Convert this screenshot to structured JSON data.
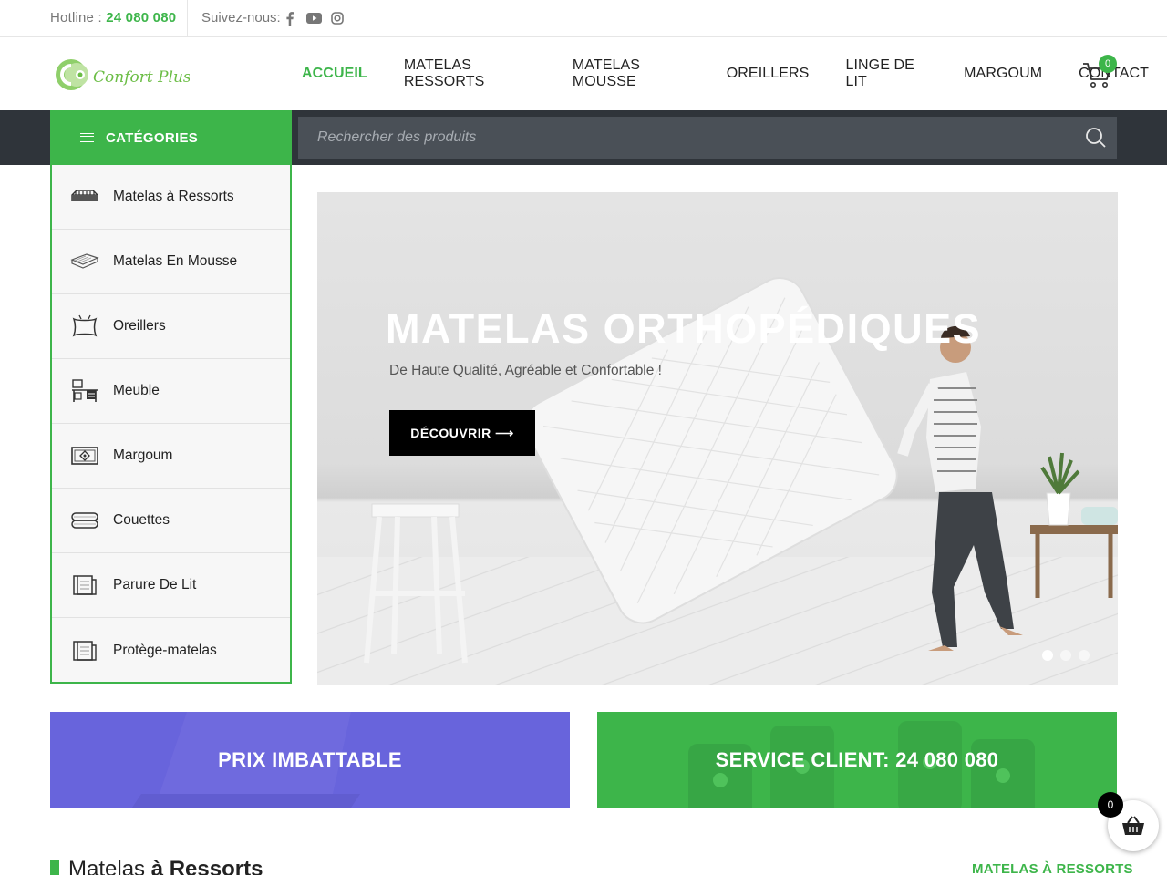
{
  "topbar": {
    "hotline_label": "Hotline : ",
    "hotline_number": "24 080 080",
    "follow_label": "Suivez-nous:"
  },
  "header": {
    "logo_text": "Confort Plus",
    "nav": [
      {
        "label": "ACCUEIL",
        "active": true
      },
      {
        "label": "MATELAS RESSORTS"
      },
      {
        "label": "MATELAS MOUSSE"
      },
      {
        "label": "OREILLERS"
      },
      {
        "label": "LINGE DE LIT"
      },
      {
        "label": "MARGOUM"
      },
      {
        "label": "CONTACT"
      }
    ],
    "cart_count": "0"
  },
  "search": {
    "categories_label": "CATÉGORIES",
    "placeholder": "Rechercher des produits"
  },
  "categories": [
    {
      "label": "Matelas à Ressorts",
      "icon": "spring-mattress-icon"
    },
    {
      "label": "Matelas En Mousse",
      "icon": "foam-mattress-icon"
    },
    {
      "label": "Oreillers",
      "icon": "pillow-icon"
    },
    {
      "label": "Meuble",
      "icon": "furniture-icon"
    },
    {
      "label": "Margoum",
      "icon": "rug-icon"
    },
    {
      "label": "Couettes",
      "icon": "duvet-icon"
    },
    {
      "label": "Parure De Lit",
      "icon": "bedding-set-icon"
    },
    {
      "label": "Protège-matelas",
      "icon": "mattress-protector-icon"
    }
  ],
  "hero": {
    "title": "MATELAS ORTHOPÉDIQUES",
    "subtitle": "De Haute Qualité, Agréable et Confortable !",
    "button": "DÉCOUVRIR ⟶",
    "slide_count": 3,
    "active_slide": 1
  },
  "banners": [
    {
      "label": "PRIX IMBATTABLE",
      "color": "#6864dc"
    },
    {
      "label": "SERVICE CLIENT: 24 080 080",
      "color": "#3db54a"
    }
  ],
  "section": {
    "title_light": "Matelas ",
    "title_bold": "à Ressorts",
    "link": "MATELAS À RESSORTS"
  },
  "floating_cart": {
    "count": "0"
  },
  "colors": {
    "accent": "#3db54a",
    "dark": "#2f343a",
    "blue": "#6864dc"
  }
}
